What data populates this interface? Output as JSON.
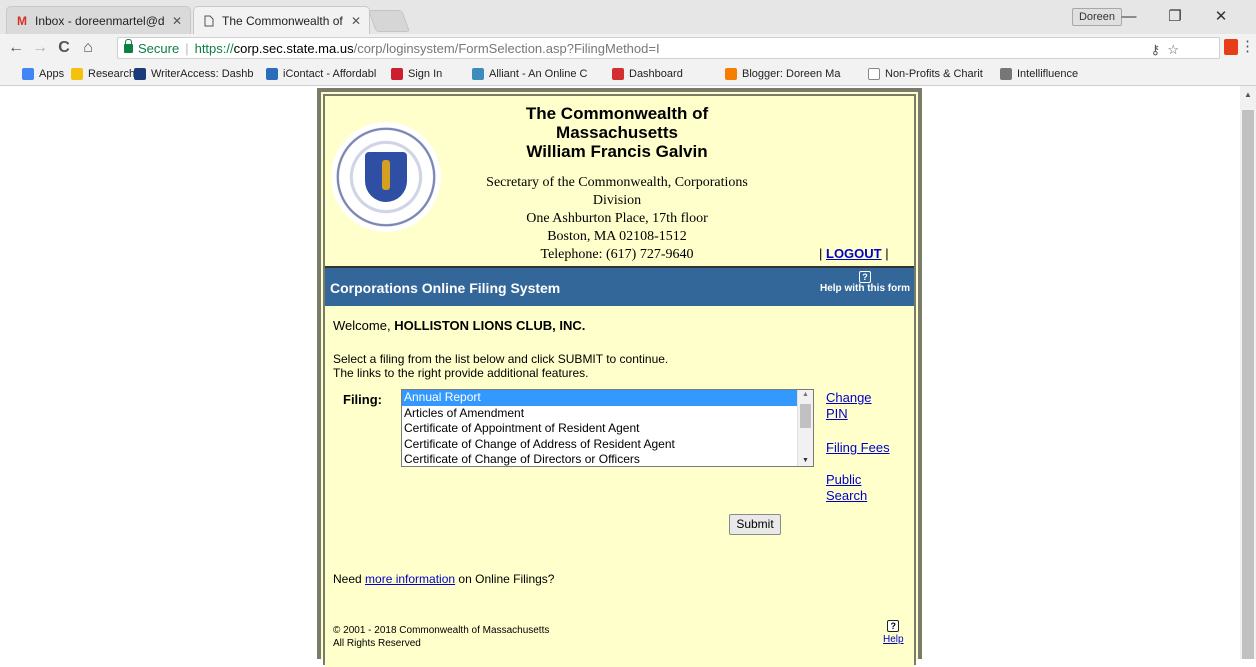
{
  "browser": {
    "tabs": [
      {
        "title": "Inbox - doreenmartel@d",
        "favicon": "gmail-icon",
        "active": false
      },
      {
        "title": "The Commonwealth of M",
        "favicon": "page-icon",
        "active": true
      }
    ],
    "profile_name": "Doreen",
    "window_controls": {
      "minimize": "—",
      "restore": "❐",
      "close": "✕"
    },
    "nav": {
      "back": "←",
      "forward": "→",
      "reload": "C",
      "home": "⌂"
    },
    "address": {
      "secure_label": "Secure",
      "scheme": "https://",
      "host": "corp.sec.state.ma.us",
      "path": "/corp/loginsystem/FormSelection.asp?FilingMethod=I"
    },
    "bookmarks": [
      {
        "label": "Apps",
        "icon": "apps-grid-icon",
        "color": "#4285f4"
      },
      {
        "label": "Research",
        "icon": "folder-icon",
        "color": "#f4c20d"
      },
      {
        "label": "WriterAccess: Dashb",
        "icon": "writeraccess-icon",
        "color": "#1a3c7a"
      },
      {
        "label": "iContact - Affordabl",
        "icon": "icontact-icon",
        "color": "#2a6ebb"
      },
      {
        "label": "Sign In",
        "icon": "signin-icon",
        "color": "#cc1f2d"
      },
      {
        "label": "Alliant - An Online C",
        "icon": "alliant-icon",
        "color": "#3c8dbc"
      },
      {
        "label": "Dashboard",
        "icon": "dashboard-icon",
        "color": "#d32f2f"
      },
      {
        "label": "Blogger: Doreen Ma",
        "icon": "blogger-icon",
        "color": "#f57d00"
      },
      {
        "label": "Non-Profits & Charit",
        "icon": "page-icon",
        "color": "#888888"
      },
      {
        "label": "Intellifluence",
        "icon": "intellifluence-icon",
        "color": "#777777"
      }
    ]
  },
  "header": {
    "title_lines": [
      "The Commonwealth of",
      "Massachusetts",
      "William Francis Galvin"
    ],
    "address_lines": [
      "Secretary of the Commonwealth, Corporations",
      "Division",
      "One Ashburton Place, 17th floor",
      "Boston, MA 02108-1512",
      "Telephone: (617) 727-9640"
    ],
    "logout_label": "LOGOUT",
    "seal_alt": "Massachusetts state seal"
  },
  "titlebar": {
    "title": "Corporations Online Filing System",
    "help_label": "Help with this form"
  },
  "content": {
    "welcome_prefix": "Welcome,",
    "organization": "HOLLISTON LIONS CLUB, INC.",
    "instruction_1": "Select a filing from the list below and click SUBMIT to continue.",
    "instruction_2": "The links to the right provide additional features.",
    "filing_label": "Filing:",
    "filing_options": [
      "Annual Report",
      "Articles of Amendment",
      "Certificate of Appointment of Resident Agent",
      "Certificate of Change of Address of Resident Agent",
      "Certificate of Change of Directors or Officers"
    ],
    "selected_option": "Annual Report",
    "side_links": {
      "change_pin": [
        "Change",
        "PIN"
      ],
      "filing_fees": "Filing Fees",
      "public_search": [
        "Public",
        "Search"
      ]
    },
    "submit_label": "Submit",
    "need_info_prefix": "Need",
    "need_info_link": "more information",
    "need_info_suffix": "on Online Filings?",
    "copyright_line_1": "© 2001 - 2018 Commonwealth of Massachusetts",
    "copyright_line_2": "All Rights Reserved",
    "help_label": "Help"
  },
  "colors": {
    "page_bg": "#ffffcc",
    "titlebar_bg": "#336699",
    "link": "#0000cc",
    "selected_option_bg": "#3399ff",
    "secure_green": "#0b8043"
  }
}
